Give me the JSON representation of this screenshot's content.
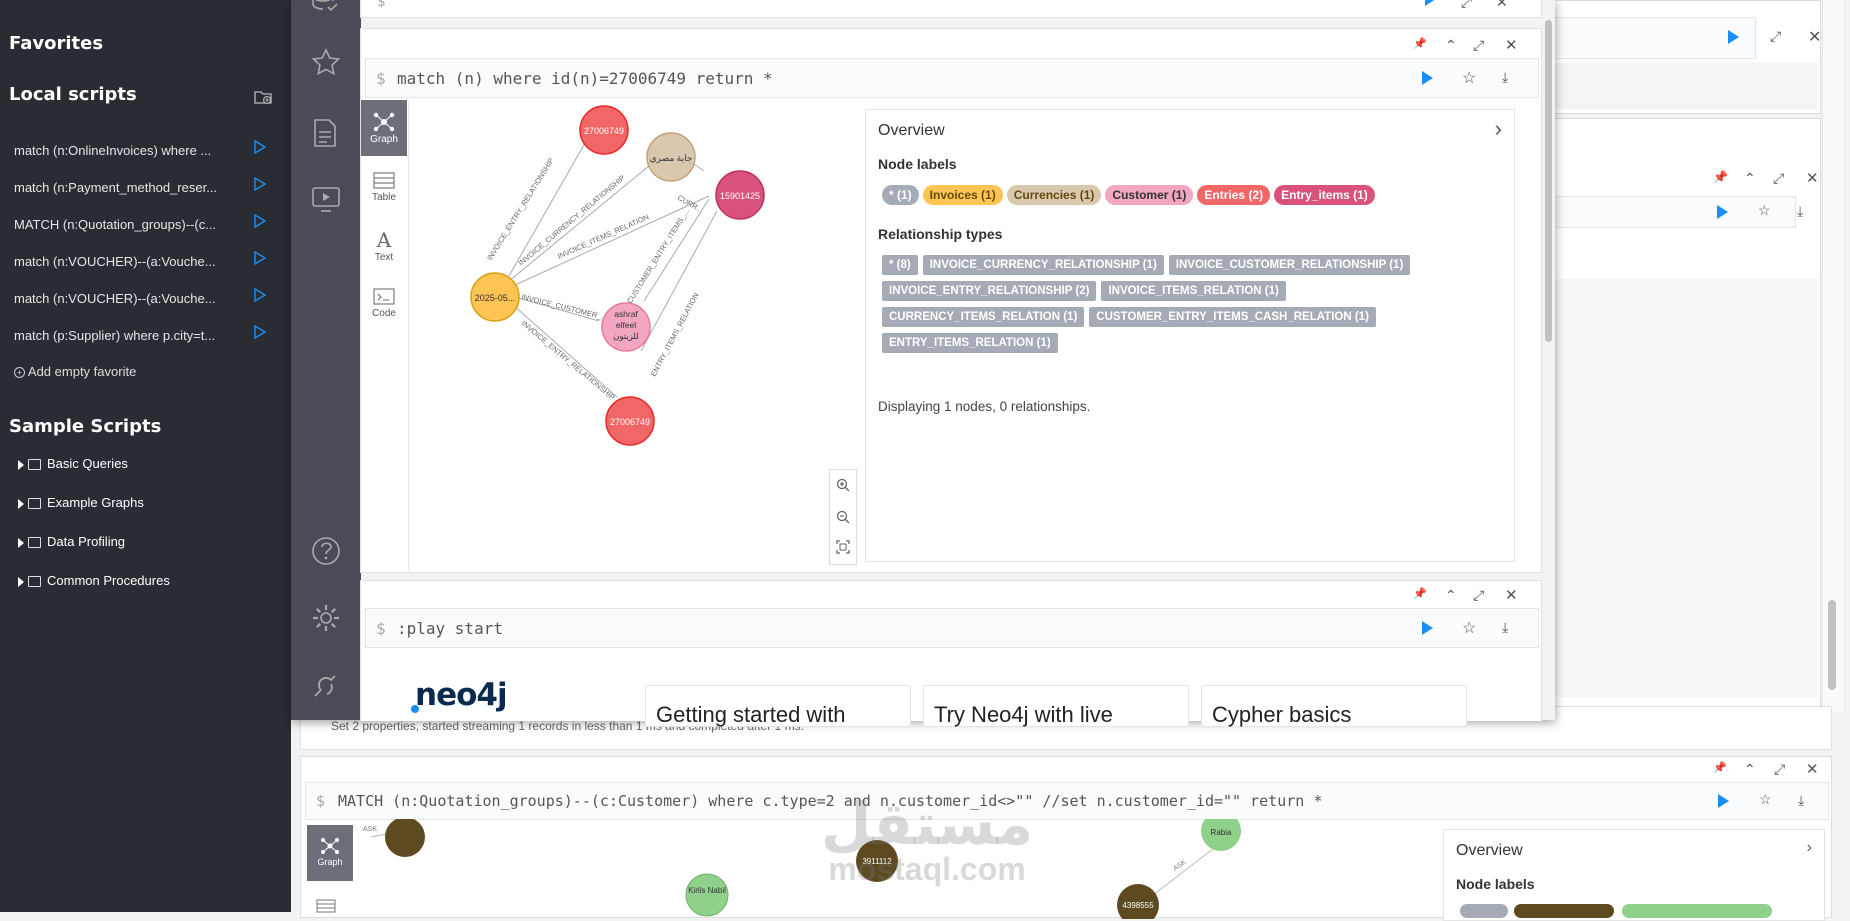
{
  "favorites": {
    "title": "Favorites",
    "local_scripts_title": "Local scripts",
    "scripts": [
      "match (n:OnlineInvoices) where ...",
      "match (n:Payment_method_reser...",
      "MATCH (n:Quotation_groups)--(c...",
      "match (n:VOUCHER)--(a:Vouche...",
      "match (n:VOUCHER)--(a:Vouche...",
      "match (p:Supplier) where p.city=t..."
    ],
    "add_empty": "Add empty favorite",
    "sample_title": "Sample Scripts",
    "samples": [
      "Basic Queries",
      "Example Graphs",
      "Data Profiling",
      "Common Procedures"
    ]
  },
  "frame1": {
    "query": "match (n) where id(n)=27006749 return *",
    "prompt": "$",
    "tabs": {
      "graph": "Graph",
      "table": "Table",
      "text": "Text",
      "code": "Code"
    },
    "overview": {
      "title": "Overview",
      "node_labels_title": "Node labels",
      "node_labels": [
        {
          "text": "* (1)",
          "bg": "#a5abb6",
          "fg": "#ffffff"
        },
        {
          "text": "Invoices (1)",
          "bg": "#ffc454",
          "fg": "#604a0e"
        },
        {
          "text": "Currencies (1)",
          "bg": "#d9c8ae",
          "fg": "#604a0e"
        },
        {
          "text": "Customer (1)",
          "bg": "#f3a6c1",
          "fg": "#333333"
        },
        {
          "text": "Entries (2)",
          "bg": "#f16667",
          "fg": "#ffffff"
        },
        {
          "text": "Entry_items (1)",
          "bg": "#d9527b",
          "fg": "#ffffff"
        }
      ],
      "rel_title": "Relationship types",
      "rel_types": [
        "* (8)",
        "INVOICE_CURRENCY_RELATIONSHIP (1)",
        "INVOICE_CUSTOMER_RELATIONSHIP (1)",
        "INVOICE_ENTRY_RELATIONSHIP (2)",
        "INVOICE_ITEMS_RELATION (1)",
        "CURRENCY_ITEMS_RELATION (1)",
        "CUSTOMER_ENTRY_ITEMS_CASH_RELATION (1)",
        "ENTRY_ITEMS_RELATION (1)"
      ],
      "status": "Displaying 1 nodes, 0 relationships."
    },
    "nodes": {
      "n1": "27006749",
      "n2": "جاية مصري",
      "n3": "15901425",
      "n4": "2025-05...",
      "n5a": "ashraf",
      "n5b": "elfeel",
      "n5c": "للزيتون",
      "n6": "27006749"
    },
    "edges": {
      "e1": "INVOICE_ENTRY_RELATIONSHIP",
      "e2": "INVOICE_CURRENCY_RELATIONSHIP",
      "e3": "CURR...",
      "e4": "INVOICE_ITEMS_RELATION",
      "e5": "CUSTOMER_ENTRY_ITEMS_...",
      "e6": "INVOICE_CUSTOMER_...",
      "e7": "ENTRY_ITEMS_RELATION",
      "e8": "INVOICE_ENTRY_RELATIONSHIP"
    }
  },
  "frame2": {
    "query": ":play start",
    "prompt": "$",
    "logo": "neo4j",
    "cards": [
      "Getting started with",
      "Try Neo4j with live",
      "Cypher basics"
    ]
  },
  "background": {
    "status_line": "Set 2 properties, started streaming 1 records in less than 1 ms and completed after 1 ms.",
    "query": "MATCH (n:Quotation_groups)--(c:Customer) where c.type=2 and n.customer_id<>\"\" //set n.customer_id=\"\" return *",
    "prompt": "$",
    "graph_tab": "Graph",
    "overview_title": "Overview",
    "node_labels_title": "Node labels",
    "nodes": [
      "Kirlis Nabil",
      "3911112",
      "4398555",
      "Rabia"
    ],
    "edge": "ASK"
  },
  "watermark": {
    "arabic": "مستقل",
    "latin": "mostaql.com"
  }
}
